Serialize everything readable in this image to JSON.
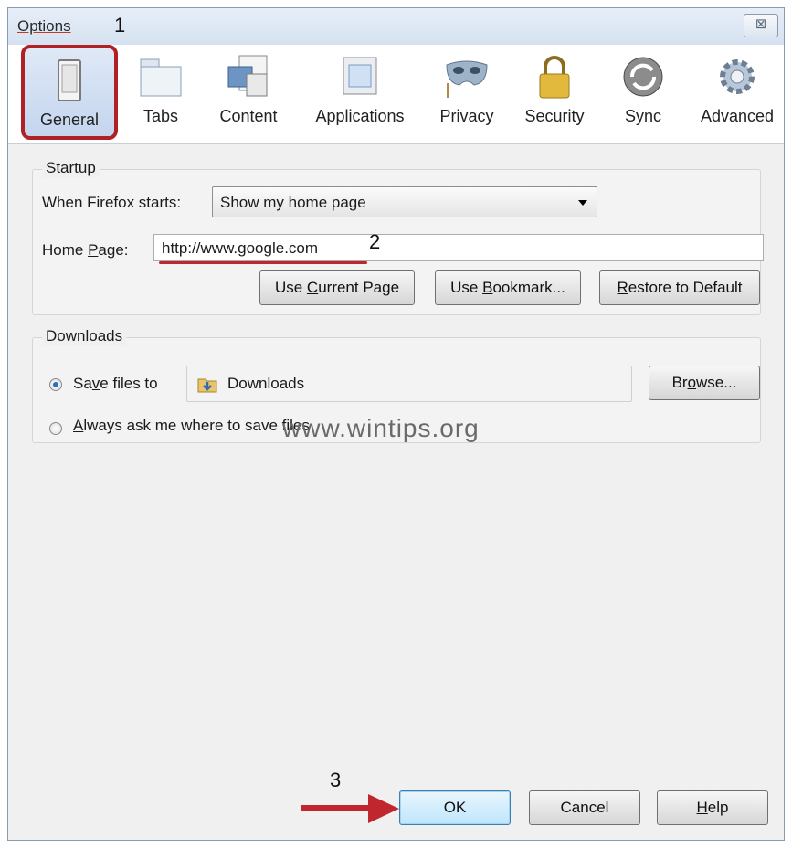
{
  "window": {
    "title": "Options",
    "close_glyph": "⊠"
  },
  "toolbar": {
    "items": [
      {
        "label": "General",
        "icon": "general-switch-icon",
        "selected": true
      },
      {
        "label": "Tabs",
        "icon": "tabs-icon"
      },
      {
        "label": "Content",
        "icon": "content-icon"
      },
      {
        "label": "Applications",
        "icon": "applications-icon"
      },
      {
        "label": "Privacy",
        "icon": "privacy-mask-icon"
      },
      {
        "label": "Security",
        "icon": "padlock-icon"
      },
      {
        "label": "Sync",
        "icon": "sync-icon"
      },
      {
        "label": "Advanced",
        "icon": "gear-icon"
      }
    ]
  },
  "startup": {
    "group_title": "Startup",
    "when_starts_label": "When Firefox starts:",
    "when_starts_value": "Show my home page",
    "home_page_label_pre": "Home ",
    "home_page_label_key": "P",
    "home_page_label_post": "age:",
    "home_page_value": "http://www.google.com",
    "btn_use_current_pre": "Use ",
    "btn_use_current_key": "C",
    "btn_use_current_post": "urrent Page",
    "btn_use_bookmark_pre": "Use ",
    "btn_use_bookmark_key": "B",
    "btn_use_bookmark_post": "ookmark...",
    "btn_restore_key": "R",
    "btn_restore_post": "estore to Default"
  },
  "downloads": {
    "group_title": "Downloads",
    "save_files_pre": "Sa",
    "save_files_key": "v",
    "save_files_post": "e files to",
    "folder_name": "Downloads",
    "browse_pre": "Br",
    "browse_key": "o",
    "browse_post": "wse...",
    "always_ask_key": "A",
    "always_ask_post": "lways ask me where to save files"
  },
  "watermark": "www.wintips.org",
  "annotations": {
    "step1": "1",
    "step2": "2",
    "step3": "3"
  },
  "buttons": {
    "ok": "OK",
    "cancel": "Cancel",
    "help_key": "H",
    "help_post": "elp"
  },
  "colors": {
    "annotation_red": "#c0262d",
    "selection_blue": "#c4d5ee"
  }
}
